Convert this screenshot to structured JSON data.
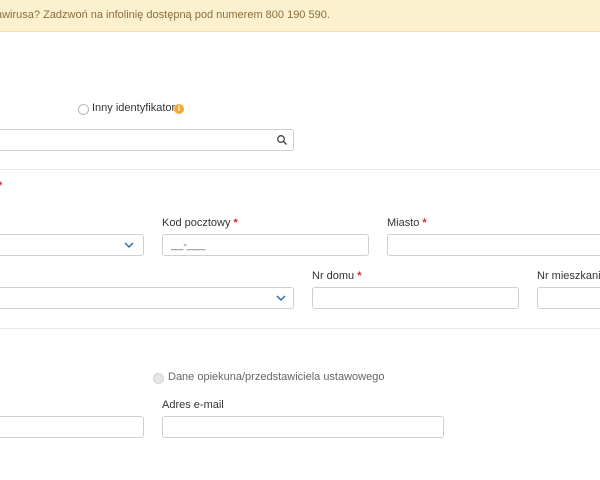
{
  "banner": {
    "text": "awirusa? Zadzwoń na infolinię dostępną pod numerem 800 190 590."
  },
  "identifier": {
    "radio_label": "Inny identyfikator",
    "info_badge": "i",
    "search_value": ""
  },
  "address": {
    "required_mark": "*",
    "postal_code_label": "Kod pocztowy",
    "postal_code_placeholder": "__-___",
    "city_label": "Miasto",
    "house_no_label": "Nr domu",
    "apartment_no_label": "Nr mieszkania"
  },
  "contact": {
    "guardian_radio_label": "Dane opiekuna/przedstawiciela ustawowego",
    "email_label": "Adres e-mail"
  },
  "colors": {
    "banner_bg": "#fcf1cf",
    "banner_text": "#8a6d3b",
    "required": "#cc2b2b",
    "chevron": "#2a6fb0",
    "badge": "#f0a93b"
  },
  "icons": {
    "search": "search-icon",
    "chevron": "chevron-down-icon",
    "info": "info-icon"
  }
}
